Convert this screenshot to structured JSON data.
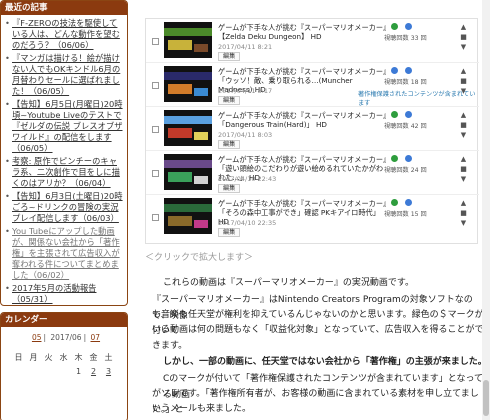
{
  "sidebar": {
    "recent_heading": "最近の記事",
    "recent_posts": [
      "『F-ZEROの技法を駆使している人は、どんな動作を望むのだろう？（06/06）",
      "『マンガは描ける！絵が描けない人でもOKキンドル6月の月替わりセールに選ばれました！（06/05）",
      "【告知】6月5日(月曜日)20時頃~Youtube Liveのテストで『ゼルダの伝説 ブレスオブザワイルド』の配信をします（06/05）",
      "考察: 原作でピンチーのキャラ系、二次創作で目をしに描くのはアリか？（06/04）",
      "【告知】6月3日(土曜日)20時ごろ~ドリンクの冒険の実況プレイ配信します（06/03）",
      "You Tubeにアップした動画が、関係ない会社から「著作権」を主張されて広告収入が奪われる件についてまとめました（06/02）",
      "2017年5月の活動報告（05/31）"
    ],
    "calendar_heading": "カレンダー",
    "calendar_nav": [
      "05",
      "2017/06",
      "07"
    ],
    "calendar_weekdays": [
      "日",
      "月",
      "火",
      "水",
      "木",
      "金",
      "土"
    ],
    "calendar_row1": [
      "",
      "",
      "",
      "",
      "1",
      "2",
      "3"
    ]
  },
  "video_list": [
    {
      "title": "ゲームが下手な人が挑む『スーパーマリオメーカー』【Zelda Deku Dungeon】 HD",
      "date": "2017/04/11 8:21",
      "views": "視聴回数 33 回",
      "edit": "編集",
      "notice": "",
      "status": "green"
    },
    {
      "title": "ゲームが下手な人が挑む『スーパーマリオメーカー』「ウッソ！敵、乗り取られる…(Muncher Madness) HD",
      "date": "2017/04/11 8:17",
      "views": "視聴回数 18 回",
      "edit": "編集",
      "notice": "著作権保護されたコンテンツが含まれています",
      "status": "blue"
    },
    {
      "title": "ゲームが下手な人が挑む『スーパーマリオメーカー』「Dangerous Train(Hard)」 HD",
      "date": "2017/04/11 8:03",
      "views": "視聴回数 42 回",
      "edit": "編集",
      "notice": "",
      "status": "green"
    },
    {
      "title": "ゲームが下手な人が挑む『スーパーマリオメーカー』「遊い頭絵のこだわりが遊い絵めるれていたかがわれた…」 HD",
      "date": "2017/04/10 22:43",
      "views": "視聴回数 24 回",
      "edit": "編集",
      "notice": "",
      "status": "green"
    },
    {
      "title": "ゲームが下手な人が挑む『スーパーマリオメーカー』「そろの森中工事ができ」確認 PKキアイロ時代」 HD",
      "date": "2017/04/10 22:35",
      "views": "視聴回数 15 回",
      "edit": "編集",
      "notice": "",
      "status": "green"
    }
  ],
  "caption": "＜クリックで拡大します＞",
  "article": {
    "p1": "これらの動画は『スーパーマリオメーカー』の実況動画です。",
    "p2a": "『スーパーマリオメーカー』はNintendo Creators Programの対象ソフトなので、映像",
    "p2b": "も音楽も任天堂が権利を抑えているんじゃないのかと思います。緑色の＄マークが付いて",
    "p2c": "いる動画は何の問題もなく「収益化対象」となっていて、広告収入を得ることができます。",
    "p3": "しかし、一部の動画に、任天堂ではない会社から「著作権」の主張が来ました。",
    "p4a": "Cのマークが付いて「著作権保護されたコンテンツが含まれています」となっている動画",
    "p4b": "がソレです。「著作権所有者が、お客様の動画に含まれている素材を申し立てました。」と",
    "p4c": "いうメールも来ました。"
  },
  "colors": {
    "widget_header": "#8b3a0f",
    "monetized": "#2e9d3d",
    "copyright": "#3d7ad6"
  }
}
